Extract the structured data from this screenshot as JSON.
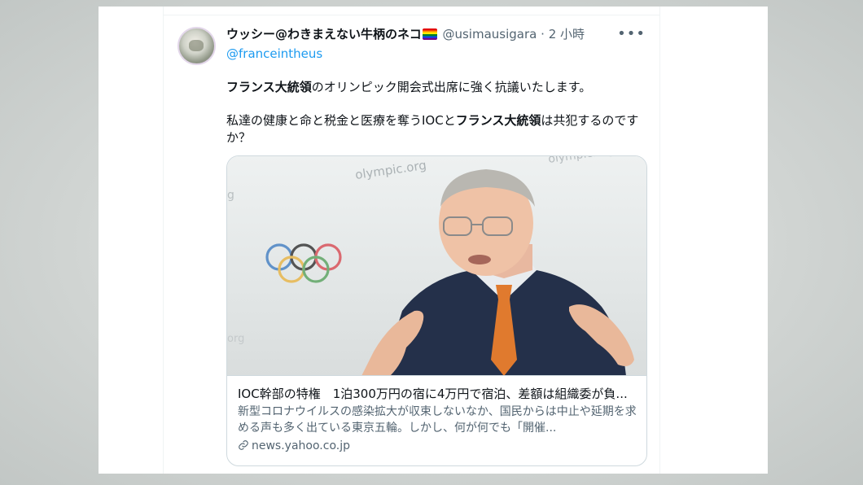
{
  "tweet": {
    "display_name": "ウッシー@わきまえない牛柄のネコ",
    "handle": "@usimausigara",
    "separator": "·",
    "time": "2 小時",
    "more": "•••",
    "reply_to": "@franceintheus",
    "text_p1_bold": "フランス大統領",
    "text_p1_rest": "のオリンピック開会式出席に強く抗議いたします。",
    "text_p2_start": "私達の健康と命と税金と医療を奪うIOCと",
    "text_p2_bold": "フランス大統領",
    "text_p2_rest": "は共犯するのですか？"
  },
  "card": {
    "image_watermark_1": "olympic.org",
    "image_watermark_2": "olympic.org",
    "title": "IOC幹部の特権　1泊300万円の宿に4万円で宿泊、差額は組織委が負...",
    "description": "新型コロナウイルスの感染拡大が収束しないなか、国民からは中止や延期を求める声も多く出ている東京五輪。しかし、何が何でも「開催...",
    "domain": "news.yahoo.co.jp"
  },
  "colors": {
    "link": "#1d9bf0",
    "secondary_text": "#536471",
    "primary_text": "#0f1419",
    "border": "#cfd9de"
  },
  "icons": {
    "avatar": "cat-avatar",
    "rainbow_flag": "rainbow-flag-icon",
    "more": "more-icon",
    "link": "link-icon"
  }
}
